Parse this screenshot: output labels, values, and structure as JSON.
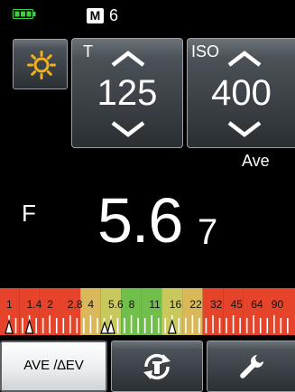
{
  "status": {
    "mode": "M",
    "memory": "6",
    "battery_level": 1.0
  },
  "shutter": {
    "label": "T",
    "value": "125"
  },
  "iso": {
    "label": "ISO",
    "value": "400",
    "sub_label": "Ave"
  },
  "aperture": {
    "label": "F",
    "main": "5.6",
    "tenths": "7"
  },
  "scale": {
    "labels": [
      "1",
      "1.4",
      "2",
      "2.8",
      "4",
      "5.6",
      "8",
      "11",
      "16",
      "22",
      "32",
      "45",
      "64",
      "90"
    ],
    "band_colors": [
      "#e5442a",
      "#e5442a",
      "#e5442a",
      "#e5442a",
      "#d9b85a",
      "#c9c85c",
      "#6fbf4a",
      "#6fbf4a",
      "#c9c85c",
      "#d9b85a",
      "#e5442a",
      "#e5442a",
      "#e5442a",
      "#e5442a"
    ],
    "markers": [
      "1",
      "1.4",
      "5.6",
      "16"
    ],
    "marker_filled": "5.6"
  },
  "buttons": {
    "ave_ev": "AVE /∆EV"
  },
  "icons": {
    "light": "sun-icon",
    "sync": "sync-icon",
    "settings": "wrench-icon"
  }
}
